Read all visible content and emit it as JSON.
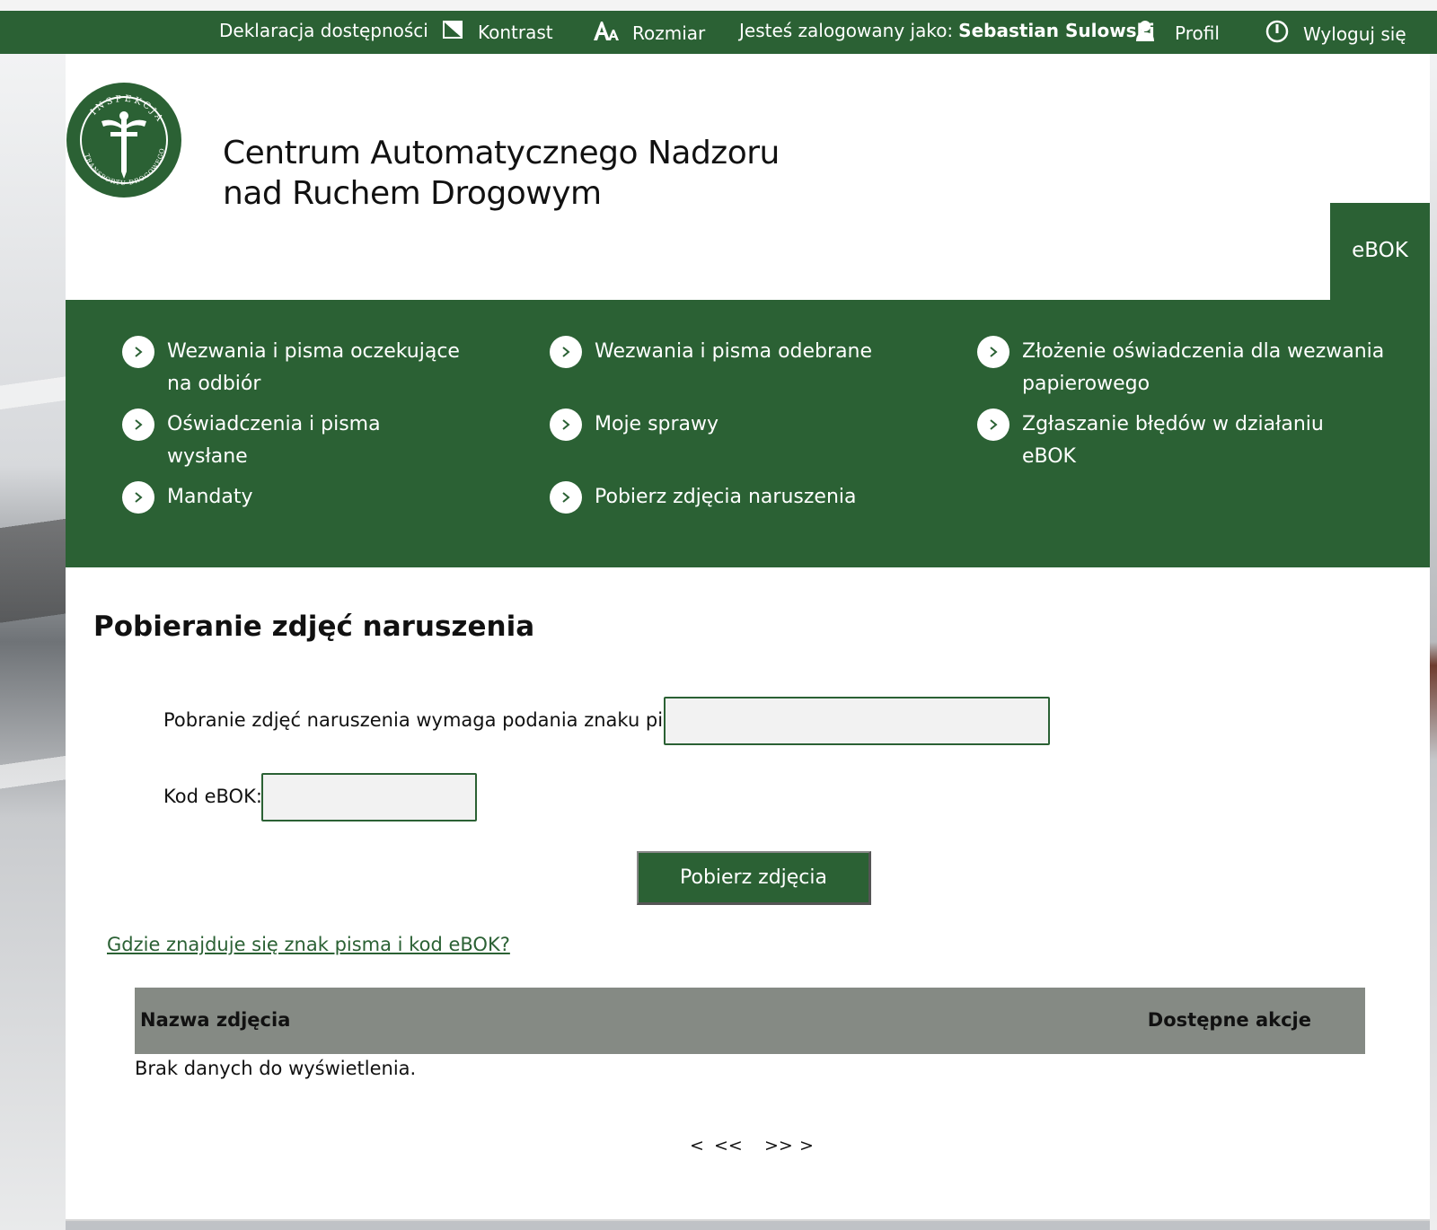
{
  "topbar": {
    "accessibility": "Deklaracja dostępności",
    "contrast": "Kontrast",
    "size": "Rozmiar",
    "logged_as_prefix": "Jesteś zalogowany jako:",
    "user_name": "Sebastian Sulowski",
    "profile": "Profil",
    "logout": "Wyloguj się"
  },
  "header": {
    "title_line1": "Centrum Automatycznego Nadzoru",
    "title_line2": "nad Ruchem Drogowym",
    "tab": "eBOK",
    "logo_text_top": "INSPEKCJA",
    "logo_text_bottom": "TRANSPORTU DROGOWEGO"
  },
  "nav": {
    "items": [
      {
        "label1": "Wezwania i pisma oczekujące",
        "label2": "na odbiór"
      },
      {
        "label1": "Wezwania i pisma odebrane",
        "label2": ""
      },
      {
        "label1": "Złożenie oświadczenia dla wezwania",
        "label2": "papierowego"
      },
      {
        "label1": "Oświadczenia i pisma wysłane",
        "label2": ""
      },
      {
        "label1": "Moje sprawy",
        "label2": ""
      },
      {
        "label1": "Zgłaszanie błędów w działaniu",
        "label2": "eBOK"
      },
      {
        "label1": "Mandaty",
        "label2": ""
      },
      {
        "label1": "Pobierz zdjęcia naruszenia",
        "label2": ""
      }
    ]
  },
  "main": {
    "page_title": "Pobieranie zdjęć naruszenia",
    "sign_label": "Pobranie zdjęć naruszenia wymaga podania znaku pisma:",
    "sign_value": "",
    "code_label": "Kod eBOK:",
    "code_value": "",
    "submit": "Pobierz zdjęcia",
    "help_link": "Gdzie znajduje się znak pisma i kod eBOK?"
  },
  "table": {
    "col_name": "Nazwa zdjęcia",
    "col_actions": "Dostępne akcje",
    "empty": "Brak danych do wyświetlenia."
  },
  "pager": {
    "prev": "<",
    "first": "<<",
    "last": ">>",
    "next": ">"
  },
  "colors": {
    "brand_green": "#2b6134",
    "table_header": "#858a84"
  },
  "icons": [
    "contrast-icon",
    "font-size-icon",
    "user-icon",
    "power-icon",
    "chevron-right-icon"
  ]
}
